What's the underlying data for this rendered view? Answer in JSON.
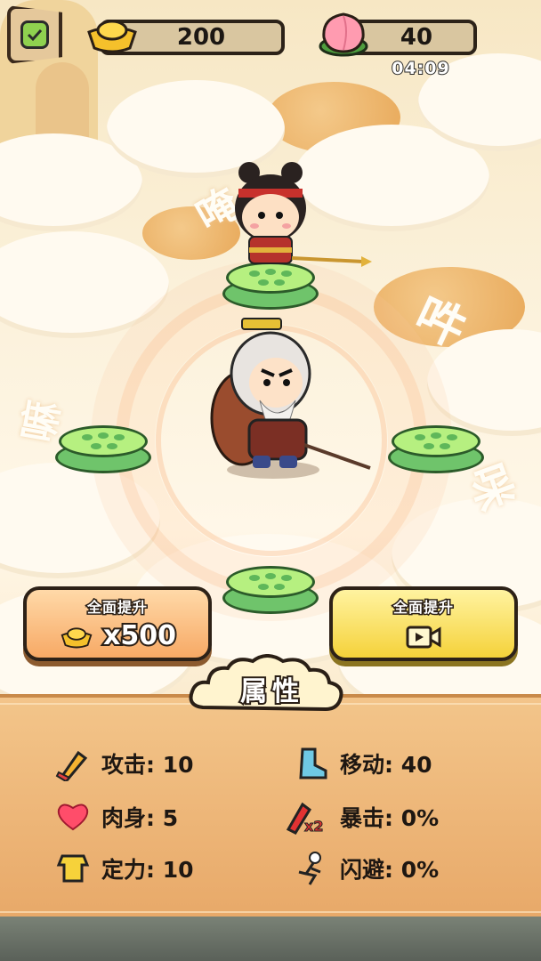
{
  "top_bar": {
    "gold_amount": "200",
    "peach_amount": "40",
    "timer": "04:09"
  },
  "decor_chars": [
    "唵",
    "吽",
    "嘛",
    "咪"
  ],
  "upgrade": {
    "gold_button": {
      "title": "全面提升",
      "cost": "x500"
    },
    "video_button": {
      "title": "全面提升"
    }
  },
  "attributes": {
    "header": "属性",
    "stats": [
      {
        "label": "攻击: 10",
        "icon": "sword-icon"
      },
      {
        "label": "移动: 40",
        "icon": "boot-icon"
      },
      {
        "label": "肉身: 5",
        "icon": "heart-icon"
      },
      {
        "label": "暴击: 0%",
        "icon": "crit-x2-icon",
        "icon_text": "x2"
      },
      {
        "label": "定力: 10",
        "icon": "armor-icon"
      },
      {
        "label": "闪避: 0%",
        "icon": "dodge-icon"
      }
    ]
  },
  "colors": {
    "lotus_green": "#b6f080",
    "panel_orange": "#f3c58a",
    "gold_button": "#f7a965",
    "video_button": "#f5d23a"
  }
}
